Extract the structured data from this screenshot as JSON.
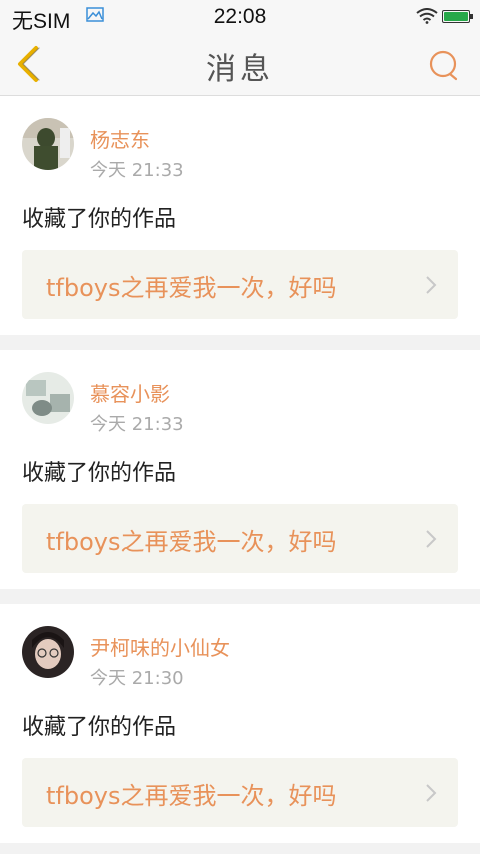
{
  "status_bar": {
    "carrier": "无SIM",
    "time": "22:08",
    "battery_color": "#27a84a"
  },
  "header": {
    "title": "消息",
    "accent": "#e8925a",
    "back_icon": "chevron-left-icon",
    "search_icon": "search-icon"
  },
  "messages": [
    {
      "user": "杨志东",
      "time": "今天 21:33",
      "action": "收藏了你的作品",
      "work_title": "tfboys之再爱我一次，好吗"
    },
    {
      "user": "慕容小影",
      "time": "今天 21:33",
      "action": "收藏了你的作品",
      "work_title": "tfboys之再爱我一次，好吗"
    },
    {
      "user": "尹柯味的小仙女",
      "time": "今天 21:30",
      "action": "收藏了你的作品",
      "work_title": "tfboys之再爱我一次，好吗"
    }
  ]
}
